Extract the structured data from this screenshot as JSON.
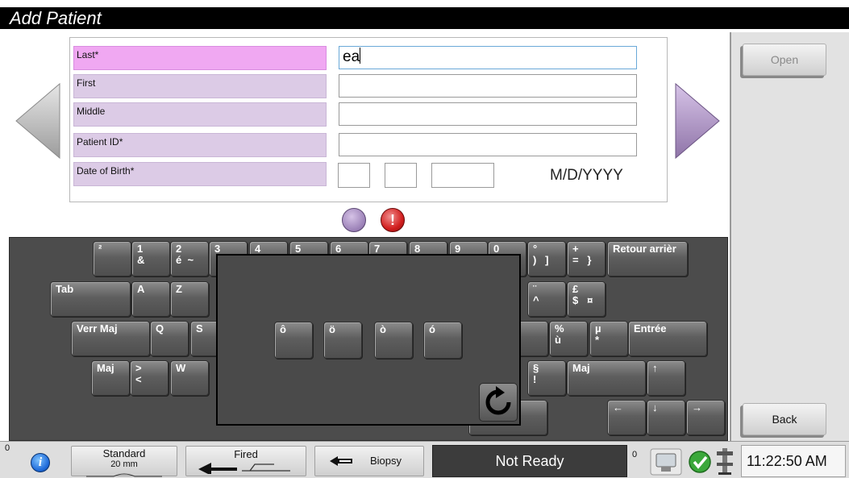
{
  "title": "Add Patient",
  "form": {
    "fields": [
      {
        "label": "Last*",
        "value": "ea",
        "active": true
      },
      {
        "label": "First",
        "value": ""
      },
      {
        "label": "Middle",
        "value": ""
      },
      {
        "label": "Patient ID*",
        "value": ""
      },
      {
        "label": "Date of Birth*",
        "value": ""
      }
    ],
    "dob_format": "M/D/YYYY"
  },
  "side": {
    "open_label": "Open",
    "back_label": "Back"
  },
  "warning_glyph": "!",
  "keyboard": {
    "row1": [
      "²",
      "1\n&",
      "2\né  ~",
      "3",
      "4",
      "5",
      "6",
      "7",
      "8",
      "9",
      "0",
      "°\n)   ]",
      "+\n=   }",
      "Retour arrièr"
    ],
    "row2": [
      "Tab",
      "A",
      "Z",
      "¨\n^",
      "£\n$   ¤"
    ],
    "row3": [
      "Verr Maj",
      "Q",
      "S",
      "",
      "%\nù",
      "µ\n*",
      "Entrée"
    ],
    "row4": [
      "Maj",
      ">\n<",
      "W",
      "§\n!",
      "Maj",
      "↑"
    ],
    "row5": [
      "",
      "←",
      "↓",
      "→"
    ],
    "popup_keys": [
      "ô",
      "ö",
      "ò",
      "ó"
    ]
  },
  "status": {
    "count_left": "0",
    "standard_label": "Standard",
    "standard_value": "20 mm",
    "fired_label": "Fired",
    "biopsy_label": "Biopsy",
    "state": "Not Ready",
    "count_right": "0",
    "time": "11:22:50 AM"
  }
}
